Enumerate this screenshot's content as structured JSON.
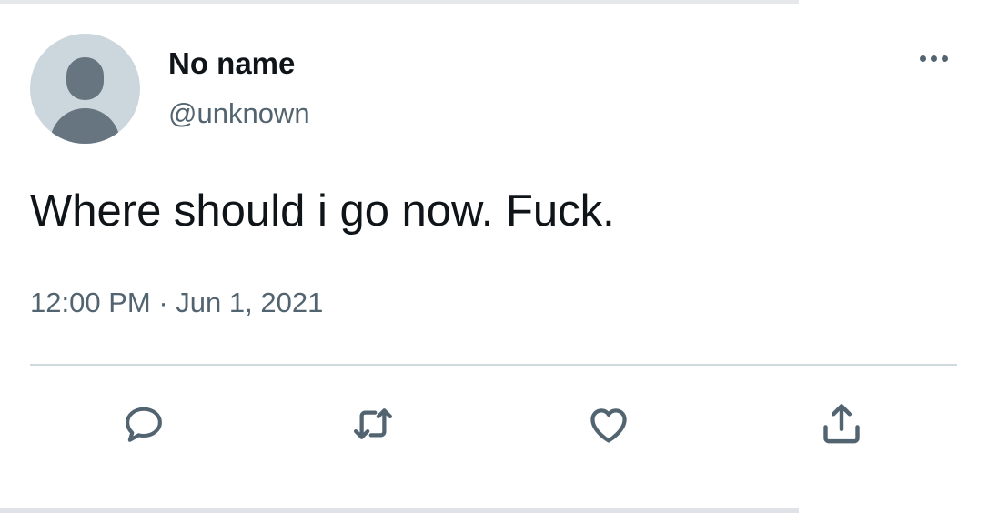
{
  "tweet": {
    "display_name": "No name",
    "handle": "@unknown",
    "text": "Where should i go now. Fuck.",
    "time": "12:00 PM",
    "separator": "·",
    "date": "Jun 1, 2021"
  },
  "icons": {
    "more": "more-horizontal-icon",
    "reply": "reply-icon",
    "retweet": "retweet-icon",
    "like": "heart-icon",
    "share": "share-icon"
  },
  "colors": {
    "text": "#0f1419",
    "secondary": "#536471",
    "divider": "#cfd9de",
    "avatar_bg": "#ccd6dd",
    "avatar_fg": "#66757f"
  }
}
